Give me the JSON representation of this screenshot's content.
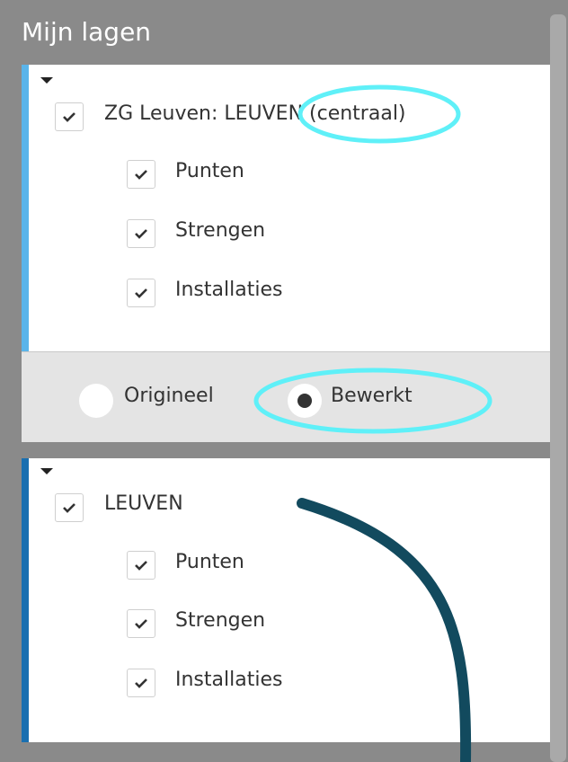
{
  "header": {
    "title": "Mijn lagen"
  },
  "layers": [
    {
      "title": "ZG Leuven: LEUVEN (centraal)",
      "accent_color": "#5ab4ea",
      "checked": true,
      "sublayers": [
        {
          "label": "Punten",
          "checked": true
        },
        {
          "label": "Strengen",
          "checked": true
        },
        {
          "label": "Installaties",
          "checked": true
        }
      ],
      "mode": {
        "options": [
          {
            "label": "Origineel",
            "selected": false
          },
          {
            "label": "Bewerkt",
            "selected": true
          }
        ]
      }
    },
    {
      "title": "LEUVEN",
      "accent_color": "#1a6fb0",
      "checked": true,
      "sublayers": [
        {
          "label": "Punten",
          "checked": true
        },
        {
          "label": "Strengen",
          "checked": true
        },
        {
          "label": "Installaties",
          "checked": true
        }
      ]
    }
  ],
  "annotations": {
    "highlight_color": "#5ff0f8",
    "arrow_color": "#124a5e"
  }
}
